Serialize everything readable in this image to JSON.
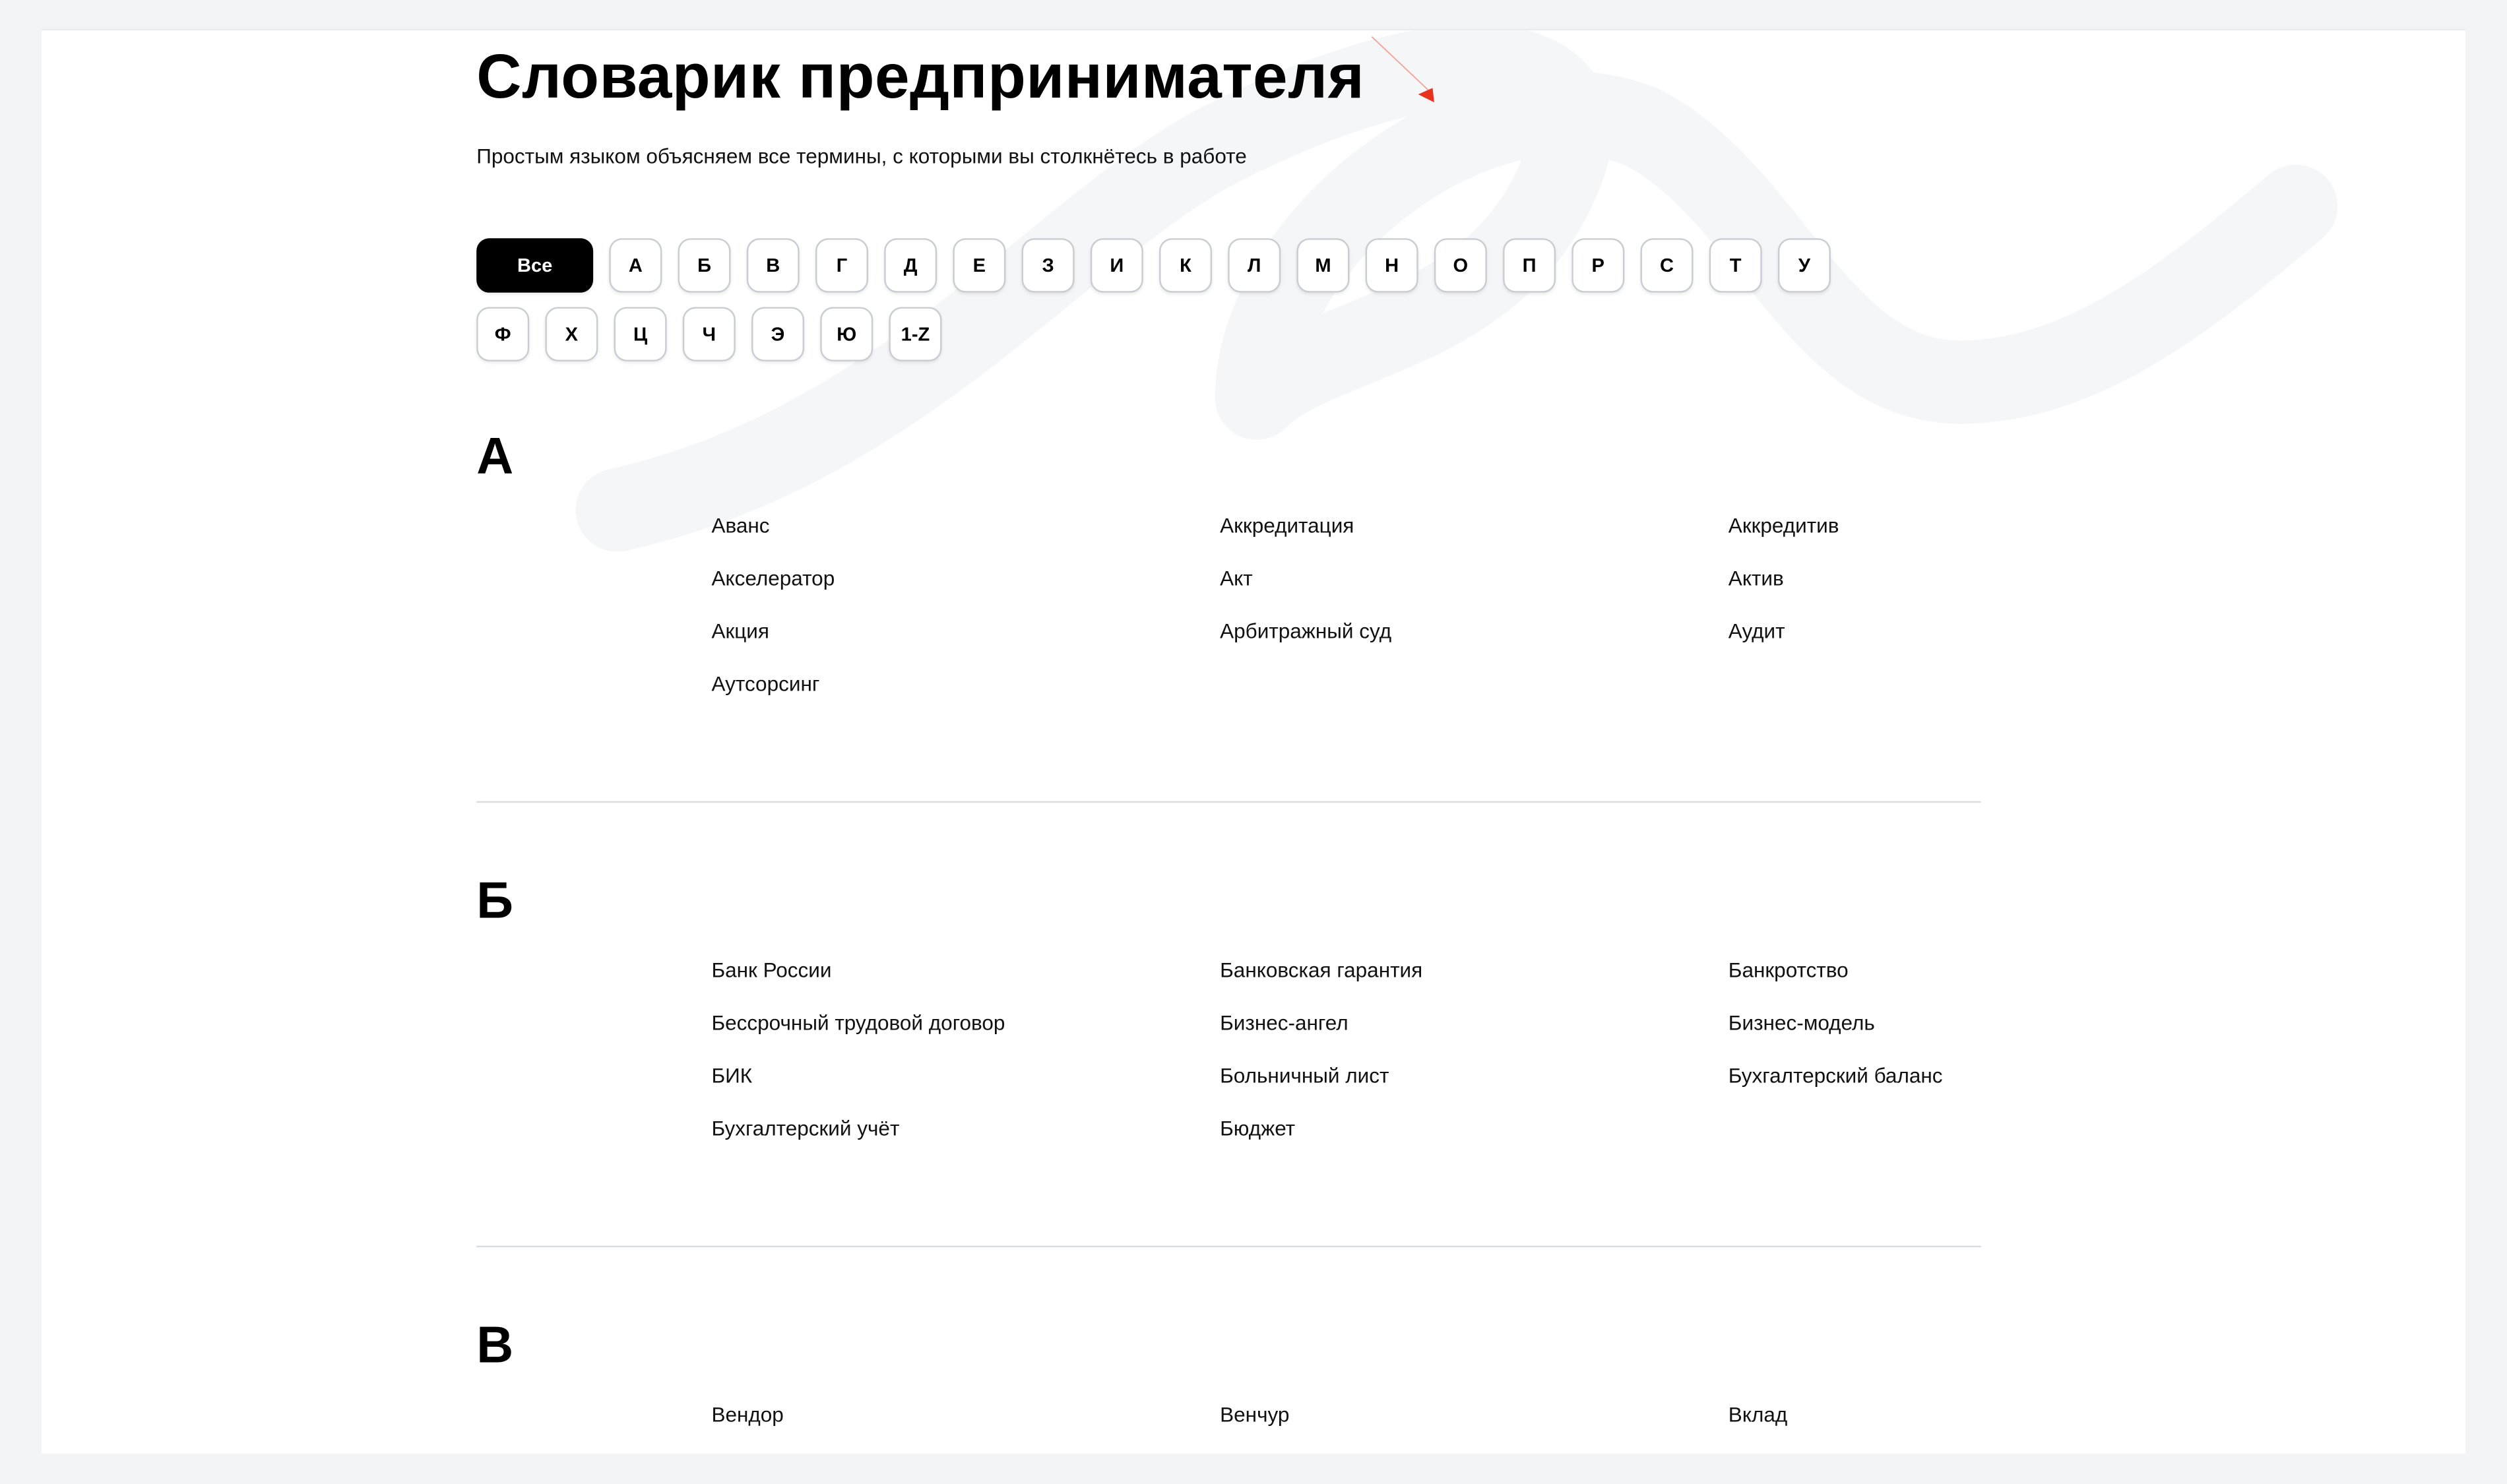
{
  "page": {
    "title": "Словарик предпринимателя",
    "subtitle": "Простым языком объясняем все термины, с которыми вы столкнётесь в работе"
  },
  "nav": {
    "all_label": "Все",
    "row1": [
      "А",
      "Б",
      "В",
      "Г",
      "Д",
      "Е",
      "З",
      "И",
      "К",
      "Л",
      "М",
      "Н",
      "О",
      "П",
      "Р",
      "С",
      "Т",
      "У"
    ],
    "row2": [
      "Ф",
      "Х",
      "Ц",
      "Ч",
      "Э",
      "Ю",
      "1-Z"
    ]
  },
  "sections": [
    {
      "letter": "А",
      "terms": [
        "Аванс",
        "Аккредитация",
        "Аккредитив",
        "Акселератор",
        "Акт",
        "Актив",
        "Акция",
        "Арбитражный суд",
        "Аудит",
        "Аутсорсинг"
      ]
    },
    {
      "letter": "Б",
      "terms": [
        "Банк России",
        "Банковская гарантия",
        "Банкротство",
        "Бессрочный трудовой договор",
        "Бизнес-ангел",
        "Бизнес-модель",
        "БИК",
        "Больничный лист",
        "Бухгалтерский баланс",
        "Бухгалтерский учёт",
        "Бюджет"
      ]
    },
    {
      "letter": "В",
      "terms": [
        "Вендор",
        "Венчур",
        "Вклад"
      ]
    }
  ],
  "colors": {
    "page_bg": "#f3f4f6",
    "card_bg": "#ffffff",
    "accent_active": "#000000",
    "decor_stroke": "#f5f6f8",
    "cursor_red": "#e8321e"
  },
  "icons": {
    "decor": "squiggle-decor-icon",
    "cursor": "cursor-arrow-icon"
  }
}
